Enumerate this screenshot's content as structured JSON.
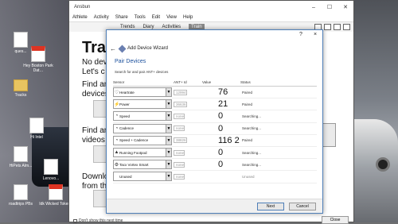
{
  "desktop": {
    "icons": [
      {
        "label": "ques..."
      },
      {
        "label": "Hey Boston Park Dat…"
      },
      {
        "label": "Tracks"
      },
      {
        "label": "Hi Intel"
      },
      {
        "label": "HiPets Alm..."
      },
      {
        "label": "Lenovo..."
      },
      {
        "label": "roadtrips PBs"
      },
      {
        "label": "Idk Wicked Tokens"
      }
    ]
  },
  "app": {
    "title": "Ansbun",
    "menu": [
      "Athlete",
      "Activity",
      "Share",
      "Tools",
      "Edit",
      "View",
      "Help"
    ],
    "nav": [
      "Trends",
      "Diary",
      "Activities",
      "Train"
    ],
    "nav_active": "Train",
    "bg_title": "Tra",
    "bg_lines": [
      "No dev",
      "Let's c",
      "Find an",
      "devices",
      "Find an",
      "videos a",
      "Downlo",
      "from th"
    ],
    "dont_show": "Don't show this next time",
    "close_label": "Close"
  },
  "wizard": {
    "help": "?",
    "close": "×",
    "back": "←",
    "title": "Add Device Wizard",
    "step": "Pair Devices",
    "subtitle": "Search for and pair ANT+ devices",
    "columns": {
      "sensor": "Sensor",
      "ant": "ANT+ Id",
      "value": "Value",
      "status": "Status"
    },
    "rows": [
      {
        "icon": "heart-icon",
        "glyph": "♡",
        "sensor": "Heartrate",
        "ant": "12994",
        "value": "76",
        "status": "Paired"
      },
      {
        "icon": "power-icon",
        "glyph": "⚡",
        "sensor": "Power",
        "ant": "36636",
        "value": "21",
        "status": "Paired"
      },
      {
        "icon": "speed-icon",
        "glyph": "◔",
        "sensor": "Speed",
        "ant": "none",
        "value": "0",
        "status": "Searching..."
      },
      {
        "icon": "cadence-icon",
        "glyph": "◔",
        "sensor": "Cadence",
        "ant": "none",
        "value": "0",
        "status": "Searching..."
      },
      {
        "icon": "speed-cadence-icon",
        "glyph": "◔",
        "sensor": "Speed + Cadence",
        "ant": "38826",
        "value": "116 2",
        "status": "Paired"
      },
      {
        "icon": "footpod-icon",
        "glyph": "▲",
        "sensor": "Running Footpod",
        "ant": "none",
        "value": "0",
        "status": "Searching..."
      },
      {
        "icon": "trainer-icon",
        "glyph": "⚙",
        "sensor": "Tacx Vortex Smart",
        "ant": "none",
        "value": "0",
        "status": "Searching..."
      },
      {
        "icon": "unused-icon",
        "glyph": "",
        "sensor": "Unused",
        "ant": "none",
        "value": "",
        "status": "Unused"
      }
    ],
    "next_label": "Next",
    "cancel_label": "Cancel"
  }
}
